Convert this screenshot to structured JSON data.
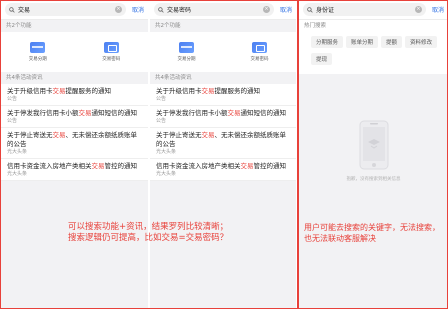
{
  "screen1": {
    "query": "交易",
    "cancel_label": "取消",
    "func_section": "共2个功能",
    "functions": [
      {
        "label": "交易分期",
        "icon": "card-icon"
      },
      {
        "label": "交易密码",
        "icon": "password-icon"
      }
    ],
    "news_section": "共4条活动资讯",
    "news": [
      {
        "pre": "关于升级信用卡",
        "hl": "交易",
        "post": "提醒服务的通知",
        "source": "公告"
      },
      {
        "pre": "关于停发我行信用卡小额",
        "hl": "交易",
        "post": "通知短信的通知",
        "source": "公告"
      },
      {
        "pre": "关于停止寄送无",
        "hl": "交易",
        "post": "、无未偿还余额纸质账单的公告",
        "source": "光大头条"
      },
      {
        "pre": "信用卡资金流入房地产类相关",
        "hl": "交易",
        "post": "管控的通知",
        "source": "光大头条"
      }
    ]
  },
  "screen2": {
    "query": "交易密码",
    "cancel_label": "取消",
    "func_section": "共2个功能",
    "functions": [
      {
        "label": "交易分期",
        "icon": "card-icon"
      },
      {
        "label": "交易密码",
        "icon": "password-icon"
      }
    ],
    "news_section": "共4条活动资讯",
    "news": [
      {
        "pre": "关于升级信用卡",
        "hl": "交易",
        "post": "提醒服务的通知",
        "source": "公告"
      },
      {
        "pre": "关于停发我行信用卡小额",
        "hl": "交易",
        "post": "通知短信的通知",
        "source": "公告"
      },
      {
        "pre": "关于停止寄送无",
        "hl": "交易",
        "post": "、无未偿还余额纸质账单的公告",
        "source": "光大头条"
      },
      {
        "pre": "信用卡资金流入房地产类相关",
        "hl": "交易",
        "post": "管控的通知",
        "source": "光大头条"
      }
    ]
  },
  "screen3": {
    "query": "身份证",
    "cancel_label": "取消",
    "hot_section": "热门搜索",
    "hot_tags": [
      "分期服务",
      "账单分期",
      "提额",
      "资料修改",
      "提现"
    ],
    "empty_text": "抱歉，没有搜索到相关信息"
  },
  "annotations": {
    "left_line1": "可以搜索功能+资讯，结果罗列比较清晰；",
    "left_line2": "搜索逻辑仍可提高，比如交易=交易密码？",
    "right_line1": "用户可能去搜索的关键字，无法搜索，",
    "right_line2": "也无法联动客服解决"
  },
  "colors": {
    "accent_red": "#e8413a",
    "link_blue": "#2d6ee3",
    "icon_blue": "#4c7ff0"
  }
}
